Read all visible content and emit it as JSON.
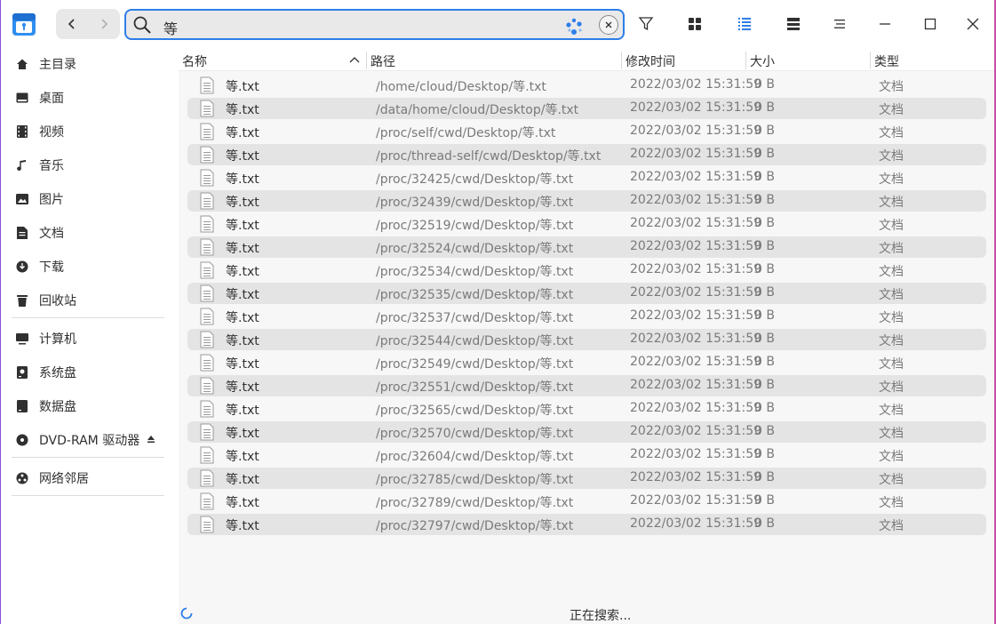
{
  "search": {
    "query": "等"
  },
  "sidebar": {
    "items": [
      {
        "label": "主目录",
        "icon": "home-icon"
      },
      {
        "label": "桌面",
        "icon": "desktop-icon"
      },
      {
        "label": "视频",
        "icon": "video-icon"
      },
      {
        "label": "音乐",
        "icon": "music-icon"
      },
      {
        "label": "图片",
        "icon": "picture-icon"
      },
      {
        "label": "文档",
        "icon": "document-icon"
      },
      {
        "label": "下载",
        "icon": "download-icon"
      },
      {
        "label": "回收站",
        "icon": "trash-icon"
      },
      {
        "label": "计算机",
        "icon": "computer-icon"
      },
      {
        "label": "系统盘",
        "icon": "disk-icon"
      },
      {
        "label": "数据盘",
        "icon": "disk-icon"
      },
      {
        "label": "DVD-RAM 驱动器",
        "icon": "dvd-icon"
      },
      {
        "label": "网络邻居",
        "icon": "network-icon"
      }
    ]
  },
  "columns": {
    "name": "名称",
    "path": "路径",
    "modified": "修改时间",
    "size": "大小",
    "type": "类型"
  },
  "rows": [
    {
      "name": "等.txt",
      "path": "/home/cloud/Desktop/等.txt",
      "modified": "2022/03/02 15:31:59",
      "size": "0 B",
      "type": "文档"
    },
    {
      "name": "等.txt",
      "path": "/data/home/cloud/Desktop/等.txt",
      "modified": "2022/03/02 15:31:59",
      "size": "0 B",
      "type": "文档"
    },
    {
      "name": "等.txt",
      "path": "/proc/self/cwd/Desktop/等.txt",
      "modified": "2022/03/02 15:31:59",
      "size": "0 B",
      "type": "文档"
    },
    {
      "name": "等.txt",
      "path": "/proc/thread-self/cwd/Desktop/等.txt",
      "modified": "2022/03/02 15:31:59",
      "size": "0 B",
      "type": "文档"
    },
    {
      "name": "等.txt",
      "path": "/proc/32425/cwd/Desktop/等.txt",
      "modified": "2022/03/02 15:31:59",
      "size": "0 B",
      "type": "文档"
    },
    {
      "name": "等.txt",
      "path": "/proc/32439/cwd/Desktop/等.txt",
      "modified": "2022/03/02 15:31:59",
      "size": "0 B",
      "type": "文档"
    },
    {
      "name": "等.txt",
      "path": "/proc/32519/cwd/Desktop/等.txt",
      "modified": "2022/03/02 15:31:59",
      "size": "0 B",
      "type": "文档"
    },
    {
      "name": "等.txt",
      "path": "/proc/32524/cwd/Desktop/等.txt",
      "modified": "2022/03/02 15:31:59",
      "size": "0 B",
      "type": "文档"
    },
    {
      "name": "等.txt",
      "path": "/proc/32534/cwd/Desktop/等.txt",
      "modified": "2022/03/02 15:31:59",
      "size": "0 B",
      "type": "文档"
    },
    {
      "name": "等.txt",
      "path": "/proc/32535/cwd/Desktop/等.txt",
      "modified": "2022/03/02 15:31:59",
      "size": "0 B",
      "type": "文档"
    },
    {
      "name": "等.txt",
      "path": "/proc/32537/cwd/Desktop/等.txt",
      "modified": "2022/03/02 15:31:59",
      "size": "0 B",
      "type": "文档"
    },
    {
      "name": "等.txt",
      "path": "/proc/32544/cwd/Desktop/等.txt",
      "modified": "2022/03/02 15:31:59",
      "size": "0 B",
      "type": "文档"
    },
    {
      "name": "等.txt",
      "path": "/proc/32549/cwd/Desktop/等.txt",
      "modified": "2022/03/02 15:31:59",
      "size": "0 B",
      "type": "文档"
    },
    {
      "name": "等.txt",
      "path": "/proc/32551/cwd/Desktop/等.txt",
      "modified": "2022/03/02 15:31:59",
      "size": "0 B",
      "type": "文档"
    },
    {
      "name": "等.txt",
      "path": "/proc/32565/cwd/Desktop/等.txt",
      "modified": "2022/03/02 15:31:59",
      "size": "0 B",
      "type": "文档"
    },
    {
      "name": "等.txt",
      "path": "/proc/32570/cwd/Desktop/等.txt",
      "modified": "2022/03/02 15:31:59",
      "size": "0 B",
      "type": "文档"
    },
    {
      "name": "等.txt",
      "path": "/proc/32604/cwd/Desktop/等.txt",
      "modified": "2022/03/02 15:31:59",
      "size": "0 B",
      "type": "文档"
    },
    {
      "name": "等.txt",
      "path": "/proc/32785/cwd/Desktop/等.txt",
      "modified": "2022/03/02 15:31:59",
      "size": "0 B",
      "type": "文档"
    },
    {
      "name": "等.txt",
      "path": "/proc/32789/cwd/Desktop/等.txt",
      "modified": "2022/03/02 15:31:59",
      "size": "0 B",
      "type": "文档"
    },
    {
      "name": "等.txt",
      "path": "/proc/32797/cwd/Desktop/等.txt",
      "modified": "2022/03/02 15:31:59",
      "size": "0 B",
      "type": "文档"
    }
  ],
  "status": {
    "text": "正在搜索..."
  },
  "colors": {
    "accent": "#2d7ee8",
    "row_alt": "#e4e4e4",
    "content_bg": "#f7f7f7"
  }
}
